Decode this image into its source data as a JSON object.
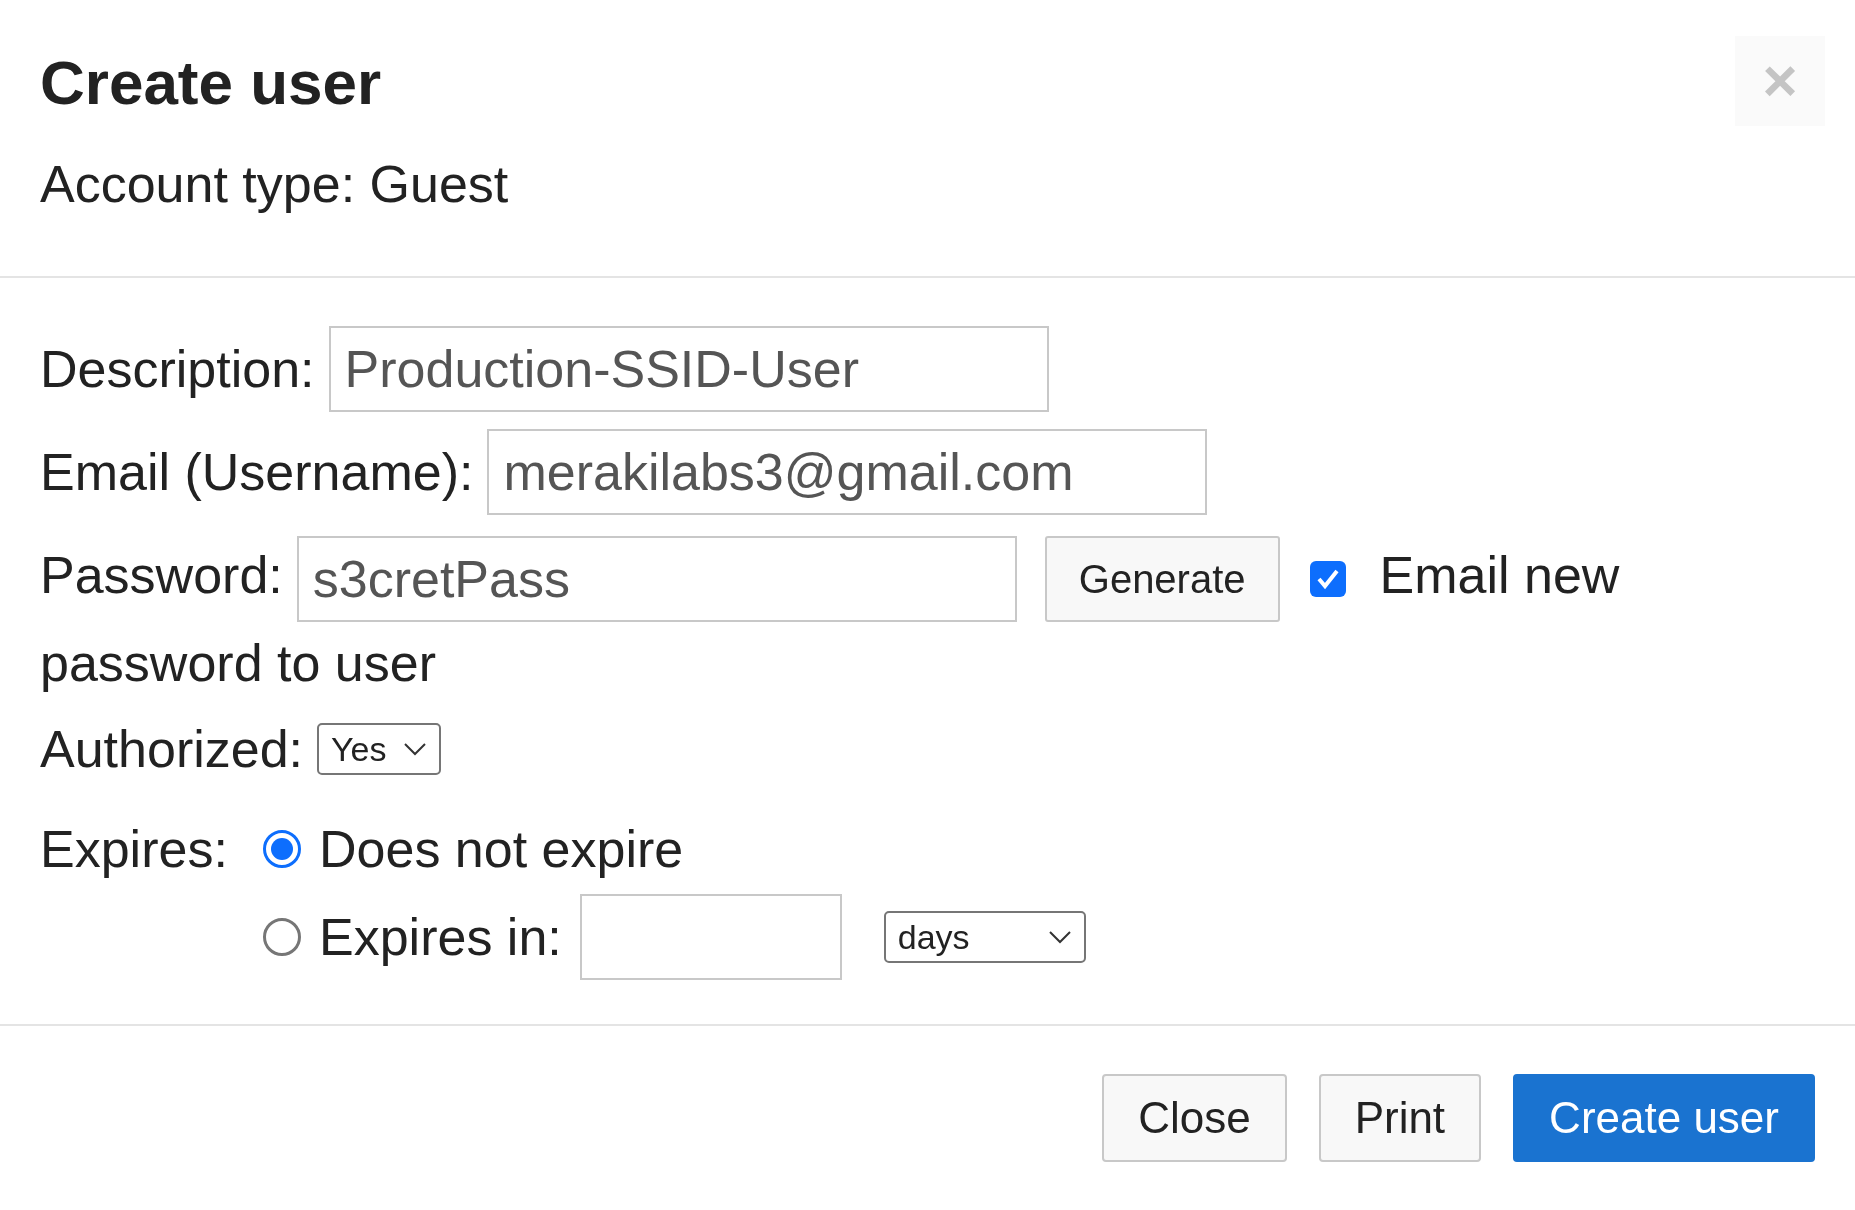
{
  "dialog": {
    "title": "Create user",
    "close_icon": "×",
    "subtitle": "Account type: Guest"
  },
  "form": {
    "description": {
      "label": "Description:",
      "value": "Production-SSID-User"
    },
    "email": {
      "label": "Email (Username):",
      "value": "merakilabs3@gmail.com"
    },
    "password": {
      "label": "Password:",
      "value": "s3cretPass",
      "generate_button": "Generate",
      "email_checkbox": {
        "label_lines": [
          "Email new",
          "password to user"
        ],
        "checked": true
      }
    },
    "authorized": {
      "label": "Authorized:",
      "value": "Yes"
    },
    "expires": {
      "label": "Expires:",
      "options": [
        {
          "kind": "plain",
          "label": "Does not expire",
          "selected": true
        },
        {
          "kind": "duration",
          "label": "Expires in:",
          "selected": false,
          "unit": "days"
        }
      ]
    }
  },
  "footer": {
    "buttons": [
      {
        "kind": "secondary",
        "label": "Close"
      },
      {
        "kind": "secondary",
        "label": "Print"
      },
      {
        "kind": "primary",
        "label": "Create user"
      }
    ]
  }
}
